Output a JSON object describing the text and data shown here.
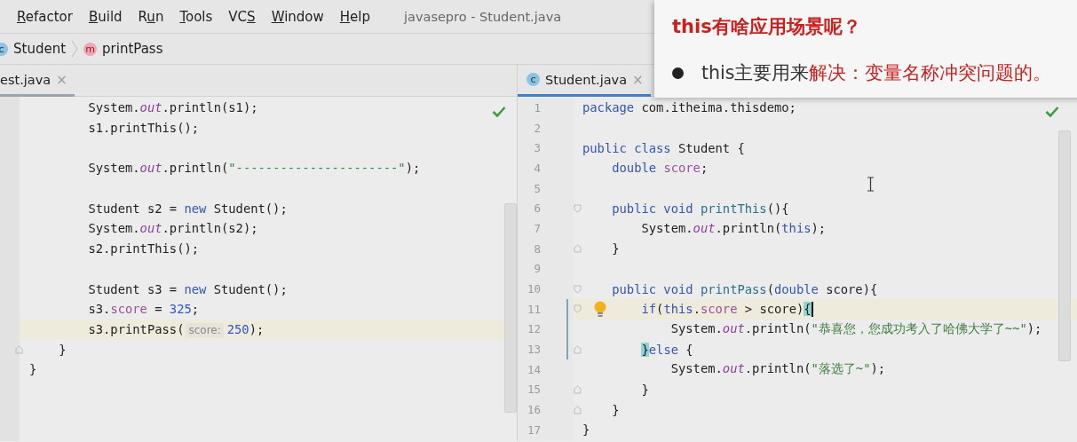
{
  "menu": [
    {
      "key": "R",
      "after": "efactor"
    },
    {
      "key": "B",
      "after": "uild"
    },
    {
      "before": "R",
      "key": "u",
      "after": "n"
    },
    {
      "key": "T",
      "after": "ools"
    },
    {
      "before": "VC",
      "key": "S"
    },
    {
      "key": "W",
      "after": "indow"
    },
    {
      "key": "H",
      "after": "elp"
    }
  ],
  "window": {
    "title": "javasepro - Student.java"
  },
  "breadcrumb": [
    {
      "icon_letter": "c",
      "kind": "class",
      "label": "Student"
    },
    {
      "icon_letter": "m",
      "kind": "method",
      "label": "printPass"
    }
  ],
  "panes": [
    {
      "focused": false,
      "tab": {
        "label": "est.java",
        "close": "×",
        "selected": true
      },
      "lines": [
        {
          "tokens": [
            {
              "kind": "plain",
              "text": "        System."
            },
            {
              "kind": "static",
              "text": "out"
            },
            {
              "kind": "plain",
              "text": ".println(s1);"
            }
          ]
        },
        {
          "tokens": [
            {
              "kind": "plain",
              "text": "        s1.printThis();"
            }
          ]
        },
        {
          "kind": "blank"
        },
        {
          "tokens": [
            {
              "kind": "plain",
              "text": "        System."
            },
            {
              "kind": "static",
              "text": "out"
            },
            {
              "kind": "plain",
              "text": ".println("
            },
            {
              "kind": "str",
              "text": "\"----------------------\""
            },
            {
              "kind": "plain",
              "text": ");"
            }
          ]
        },
        {
          "kind": "blank"
        },
        {
          "tokens": [
            {
              "kind": "plain",
              "text": "        Student s2 = "
            },
            {
              "kind": "kw",
              "text": "new"
            },
            {
              "kind": "plain",
              "text": " Student();"
            }
          ]
        },
        {
          "tokens": [
            {
              "kind": "plain",
              "text": "        System."
            },
            {
              "kind": "static",
              "text": "out"
            },
            {
              "kind": "plain",
              "text": ".println(s2);"
            }
          ]
        },
        {
          "tokens": [
            {
              "kind": "plain",
              "text": "        s2.printThis();"
            }
          ]
        },
        {
          "kind": "blank"
        },
        {
          "tokens": [
            {
              "kind": "plain",
              "text": "        Student s3 = "
            },
            {
              "kind": "kw",
              "text": "new"
            },
            {
              "kind": "plain",
              "text": " Student();"
            }
          ]
        },
        {
          "tokens": [
            {
              "kind": "plain",
              "text": "        s3."
            },
            {
              "kind": "field",
              "text": "score"
            },
            {
              "kind": "plain",
              "text": " = "
            },
            {
              "kind": "num",
              "text": "325"
            },
            {
              "kind": "plain",
              "text": ";"
            }
          ]
        },
        {
          "current": true,
          "tokens": [
            {
              "kind": "plain",
              "text": "        s3.printPass("
            },
            {
              "kind": "hint",
              "text": "score:"
            },
            {
              "kind": "num",
              "text": "250"
            },
            {
              "kind": "plain",
              "text": ");"
            }
          ]
        },
        {
          "fold_end": true,
          "tokens": [
            {
              "kind": "plain",
              "text": "    }"
            }
          ]
        },
        {
          "tokens": [
            {
              "kind": "plain",
              "text": "}"
            }
          ]
        }
      ]
    },
    {
      "focused": true,
      "tab": {
        "label": "Student.java",
        "close": "×",
        "selected": true,
        "icon_letter": "c"
      },
      "lines": [
        {
          "number": "1",
          "tokens": [
            {
              "kind": "kw",
              "text": "package"
            },
            {
              "kind": "plain",
              "text": " com.itheima.thisdemo;"
            }
          ]
        },
        {
          "number": "2",
          "kind": "blank"
        },
        {
          "number": "3",
          "tokens": [
            {
              "kind": "kw",
              "text": "public class"
            },
            {
              "kind": "plain",
              "text": " Student {"
            }
          ]
        },
        {
          "number": "4",
          "tokens": [
            {
              "kind": "kw",
              "text": "    double "
            },
            {
              "kind": "field",
              "text": "score"
            },
            {
              "kind": "plain",
              "text": ";"
            }
          ]
        },
        {
          "number": "5",
          "kind": "blank"
        },
        {
          "number": "6",
          "fold_start": true,
          "tokens": [
            {
              "kind": "kw",
              "text": "    public void "
            },
            {
              "kind": "decl",
              "text": "printThis"
            },
            {
              "kind": "plain",
              "text": "(){"
            }
          ]
        },
        {
          "number": "7",
          "tokens": [
            {
              "kind": "plain",
              "text": "        System."
            },
            {
              "kind": "static",
              "text": "out"
            },
            {
              "kind": "plain",
              "text": ".println("
            },
            {
              "kind": "kw",
              "text": "this"
            },
            {
              "kind": "plain",
              "text": ");"
            }
          ]
        },
        {
          "number": "8",
          "fold_end": true,
          "tokens": [
            {
              "kind": "plain",
              "text": "    }"
            }
          ]
        },
        {
          "number": "9",
          "kind": "blank"
        },
        {
          "number": "10",
          "fold_start": true,
          "tokens": [
            {
              "kind": "kw",
              "text": "    public void "
            },
            {
              "kind": "decl",
              "text": "printPass"
            },
            {
              "kind": "plain",
              "text": "("
            },
            {
              "kind": "kw",
              "text": "double"
            },
            {
              "kind": "plain",
              "text": " score){"
            }
          ]
        },
        {
          "number": "11",
          "fold_start": true,
          "current": true,
          "changed": true,
          "intention": true,
          "caret": true,
          "tokens": [
            {
              "kind": "kw",
              "text": "        if"
            },
            {
              "kind": "plain",
              "text": "("
            },
            {
              "kind": "kw",
              "text": "this"
            },
            {
              "kind": "plain",
              "text": "."
            },
            {
              "kind": "field",
              "text": "score"
            },
            {
              "kind": "plain",
              "text": " > score)"
            },
            {
              "kind": "match",
              "text": "{"
            }
          ]
        },
        {
          "number": "12",
          "changed": true,
          "tokens": [
            {
              "kind": "plain",
              "text": "            System."
            },
            {
              "kind": "static",
              "text": "out"
            },
            {
              "kind": "plain",
              "text": ".println("
            },
            {
              "kind": "str",
              "text": "\"恭喜您，您成功考入了哈佛大学了~~\""
            },
            {
              "kind": "plain",
              "text": ");"
            }
          ]
        },
        {
          "number": "13",
          "fold_end": true,
          "changed": true,
          "tokens": [
            {
              "kind": "match",
              "text": "        }"
            },
            {
              "kind": "kw",
              "text": "else"
            },
            {
              "kind": "plain",
              "text": " {"
            }
          ]
        },
        {
          "number": "14",
          "tokens": [
            {
              "kind": "plain",
              "text": "            System."
            },
            {
              "kind": "static",
              "text": "out"
            },
            {
              "kind": "plain",
              "text": ".println("
            },
            {
              "kind": "str",
              "text": "\"落选了~\""
            },
            {
              "kind": "plain",
              "text": ");"
            }
          ]
        },
        {
          "number": "15",
          "fold_end": true,
          "tokens": [
            {
              "kind": "plain",
              "text": "        }"
            }
          ]
        },
        {
          "number": "16",
          "fold_end": true,
          "tokens": [
            {
              "kind": "plain",
              "text": "    }"
            }
          ]
        },
        {
          "number": "17",
          "tokens": [
            {
              "kind": "plain",
              "text": "}"
            }
          ]
        }
      ]
    }
  ],
  "callout": {
    "title": "this有啥应用场景呢？",
    "bullet": [
      {
        "kind": "plain",
        "text": "this主要用来"
      },
      {
        "kind": "emphasis",
        "text": "解决：变量名称冲突问题的。"
      }
    ]
  }
}
